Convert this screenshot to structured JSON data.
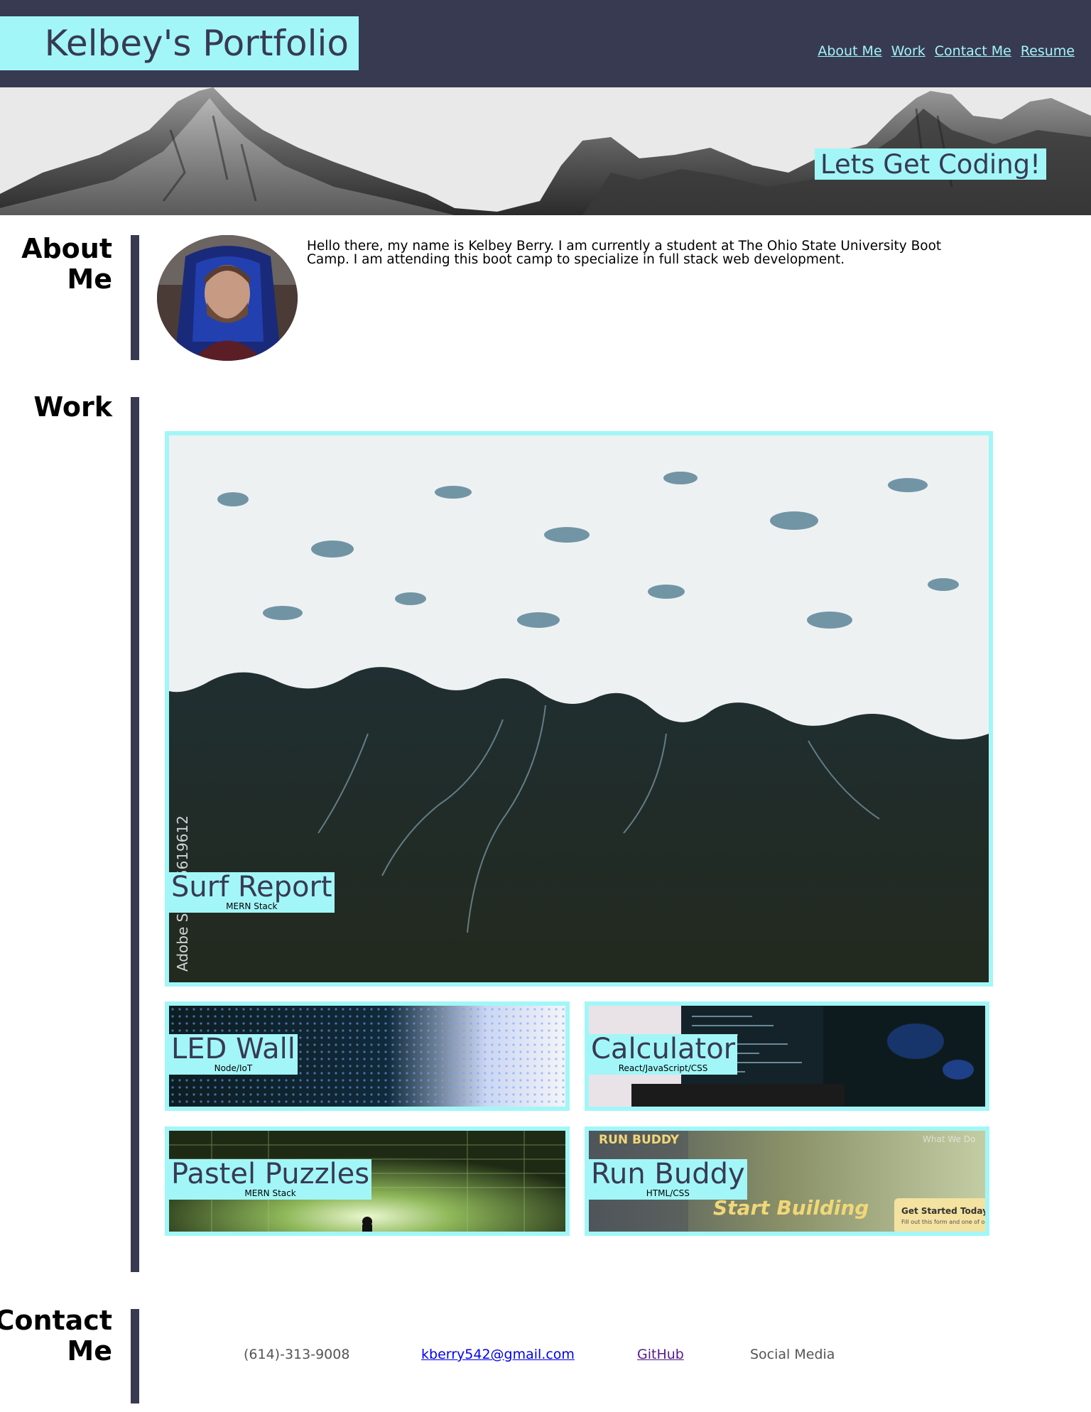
{
  "header": {
    "title": "Kelbey's Portfolio",
    "nav": [
      "About Me",
      "Work",
      "Contact Me",
      "Resume"
    ]
  },
  "hero": {
    "tagline": "Lets Get Coding!"
  },
  "about": {
    "heading_line1": "About",
    "heading_line2": "Me",
    "text": "Hello there, my name is Kelbey Berry. I am currently a student at The Ohio State University Boot Camp. I am attending this boot camp to specialize in full stack web development."
  },
  "work": {
    "heading": "Work",
    "projects": [
      {
        "name": "Surf Report",
        "tech": "MERN Stack"
      },
      {
        "name": "LED Wall",
        "tech": "Node/IoT"
      },
      {
        "name": "Calculator",
        "tech": "React/JavaScript/CSS"
      },
      {
        "name": "Pastel Puzzles",
        "tech": "MERN Stack"
      },
      {
        "name": "Run Buddy",
        "tech": "HTML/CSS"
      }
    ],
    "image_text": {
      "surf_watermark": "Adobe S     #195619612",
      "runbuddy_brand": "RUN BUDDY",
      "runbuddy_nav": "What We Do",
      "runbuddy_headline": "Start Building",
      "runbuddy_cta_title": "Get Started Today",
      "runbuddy_cta_sub": "Fill out this form and one of o"
    }
  },
  "contact": {
    "heading_line1": "Contact",
    "heading_line2": "Me",
    "phone": "(614)-313-9008",
    "email": "kberry542@gmail.com",
    "github": "GitHub",
    "social": "Social Media"
  },
  "colors": {
    "accent": "#a2f6f8",
    "dark": "#383a52"
  }
}
